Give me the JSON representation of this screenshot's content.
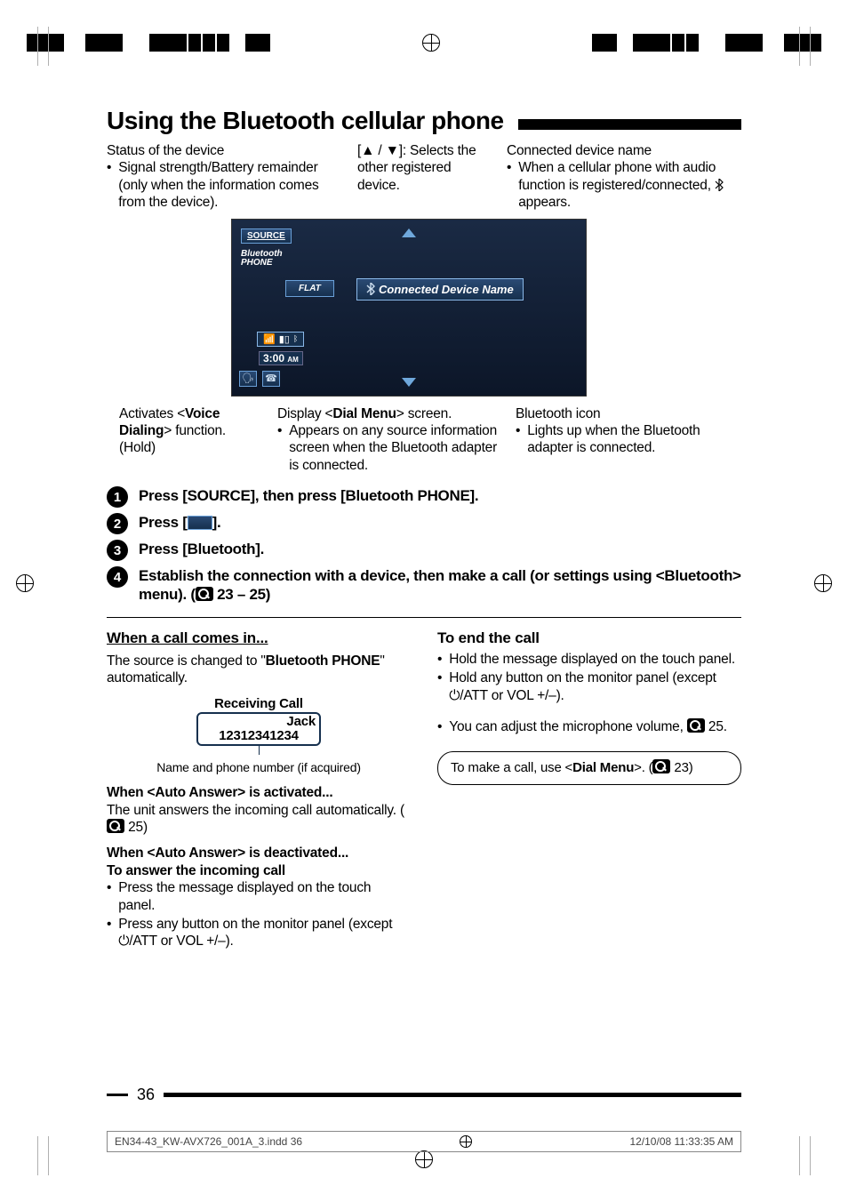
{
  "page_number": "36",
  "title": "Using the Bluetooth cellular phone",
  "top_callouts": {
    "left": {
      "heading": "Status of the device",
      "bullet_pre": "Signal strength/Battery remainder (only when the information comes from the device)."
    },
    "mid": {
      "text_pre": "[",
      "arrows": "▲ / ▼",
      "text_post": "]: Selects the other registered device."
    },
    "right": {
      "heading": "Connected device name",
      "bullet_pre": "When a cellular phone with audio function is registered/connected, ",
      "bullet_post": " appears."
    }
  },
  "screen": {
    "source_btn": "SOURCE",
    "source_label_1": "Bluetooth",
    "source_label_2": "PHONE",
    "flat": "FLAT",
    "connected": "Connected Device Name",
    "clock": "3:00",
    "clock_ampm": "AM"
  },
  "bottom_callouts": {
    "a1": "Activates <",
    "a2": "Voice Dialing",
    "a3": "> function. (Hold)",
    "b1": "Display <",
    "b2": "Dial Menu",
    "b3": "> screen.",
    "b_bullet": "Appears on any source information screen when the Bluetooth adapter is connected.",
    "c_head": "Bluetooth icon",
    "c_bullet": "Lights up when the Bluetooth adapter is connected."
  },
  "steps": {
    "s1": "Press [SOURCE], then press [Bluetooth PHONE].",
    "s2a": "Press [",
    "s2b": "].",
    "s3": "Press [Bluetooth].",
    "s4a": "Establish the connection with a device, then make a call (or settings using <Bluetooth> menu). (",
    "s4b": " 23 – 25)"
  },
  "left_col": {
    "h1": "When a call comes in...",
    "p1a": "The source is changed to \"",
    "p1b": "Bluetooth PHONE",
    "p1c": "\" automatically.",
    "callbox_label": "Receiving Call",
    "callbox_name": "Jack",
    "callbox_num": "12312341234",
    "caption": "Name and phone number (if acquired)",
    "h2": "When <Auto Answer> is activated...",
    "p2a": "The unit answers the incoming call automatically. (",
    "p2b": " 25)",
    "h3": "When <Auto Answer> is deactivated...",
    "h4": "To answer the incoming call",
    "li1": "Press the message displayed on the touch panel.",
    "li2a": "Press any button on the monitor panel (except ",
    "li2b": "/ATT or VOL +/–)."
  },
  "right_col": {
    "h1": "To end the call",
    "li1": "Hold the message displayed on the touch panel.",
    "li2a": "Hold any button on the monitor panel (except ",
    "li2b": "/ATT or VOL +/–).",
    "li3a": "You can adjust the microphone volume, ",
    "li3b": " 25.",
    "box_a": "To make a call, use <",
    "box_b": "Dial Menu",
    "box_c": ">. (",
    "box_d": " 23)"
  },
  "footer": {
    "file": "EN34-43_KW-AVX726_001A_3.indd   36",
    "ts": "12/10/08   11:33:35 AM"
  }
}
